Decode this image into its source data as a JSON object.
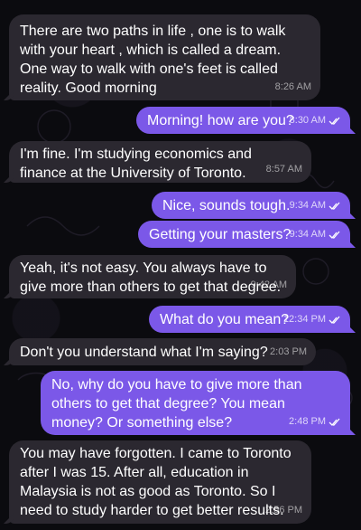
{
  "messages": [
    {
      "dir": "in",
      "text": "There are two paths in life , one is to walk with your heart , which is called a dream. One way to walk with one's feet is called reality. Good morning",
      "time": "8:26 AM"
    },
    {
      "dir": "out",
      "text": "Morning! how are you?",
      "time": "8:30 AM",
      "read_icon": "double-check-icon"
    },
    {
      "dir": "in",
      "text": "I'm fine. I'm studying economics and finance at the University of Toronto.",
      "time": "8:57 AM"
    },
    {
      "dir": "out",
      "text": "Nice, sounds tough.",
      "time": "9:34 AM",
      "read_icon": "double-check-icon"
    },
    {
      "dir": "out",
      "text": "Getting your masters?",
      "time": "9:34 AM",
      "read_icon": "double-check-icon"
    },
    {
      "dir": "in",
      "text": "Yeah, it's not easy. You always have to give more than others to get that degree.",
      "time": "9:42 AM"
    },
    {
      "dir": "out",
      "text": "What do you mean?",
      "time": "12:34 PM",
      "read_icon": "double-check-icon"
    },
    {
      "dir": "in",
      "text": "Don't you understand what I'm saying?",
      "time": "2:03 PM"
    },
    {
      "dir": "out",
      "text": "No, why do you have to give more than others to get that degree? You mean money? Or something else?",
      "time": "2:48 PM",
      "read_icon": "double-check-icon"
    },
    {
      "dir": "in",
      "text": "You may have forgotten. I came to Toronto after I was 15. After all, education in Malaysia is not as good as Toronto. So I need to study harder to get better results.",
      "time": "2:56 PM"
    }
  ],
  "colors": {
    "incoming_bubble": "#2b2830",
    "outgoing_bubble": "#7b58e8",
    "background": "#0b0b0f"
  }
}
